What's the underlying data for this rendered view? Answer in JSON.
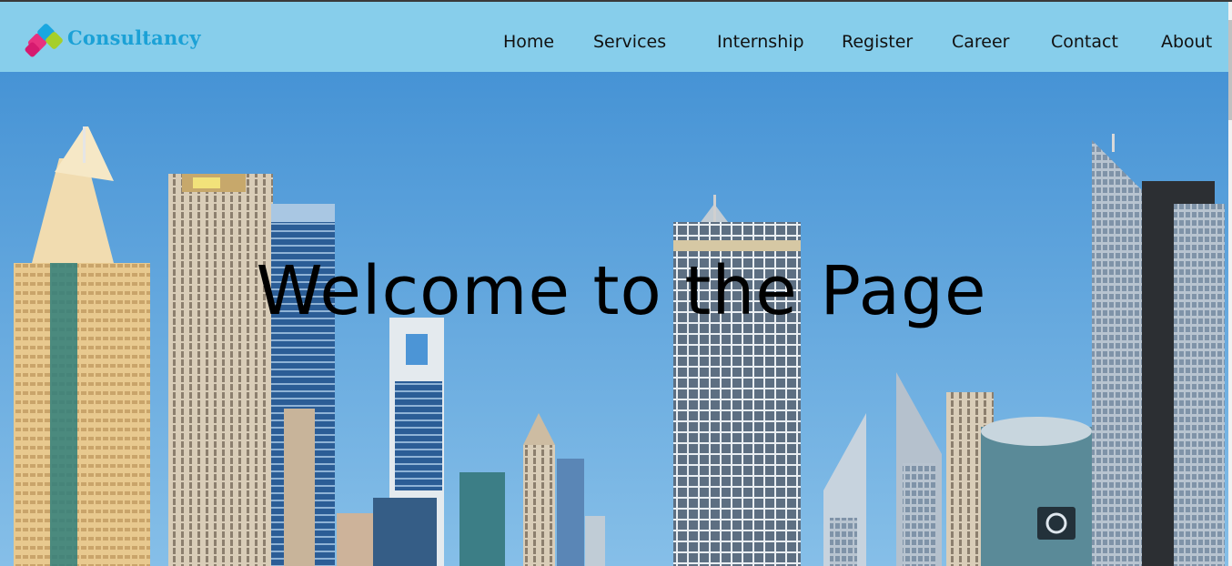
{
  "header": {
    "brand": "Consultancy",
    "logo_icon": "diamond-logo-icon",
    "brand_color": "#1ba1d6",
    "background": "#87ceeb"
  },
  "nav": {
    "items": [
      {
        "label": "Home"
      },
      {
        "label": "Services"
      },
      {
        "label": "Internship"
      },
      {
        "label": "Register"
      },
      {
        "label": "Career"
      },
      {
        "label": "Contact"
      },
      {
        "label": "About"
      }
    ]
  },
  "hero": {
    "title": "Welcome to the Page"
  }
}
